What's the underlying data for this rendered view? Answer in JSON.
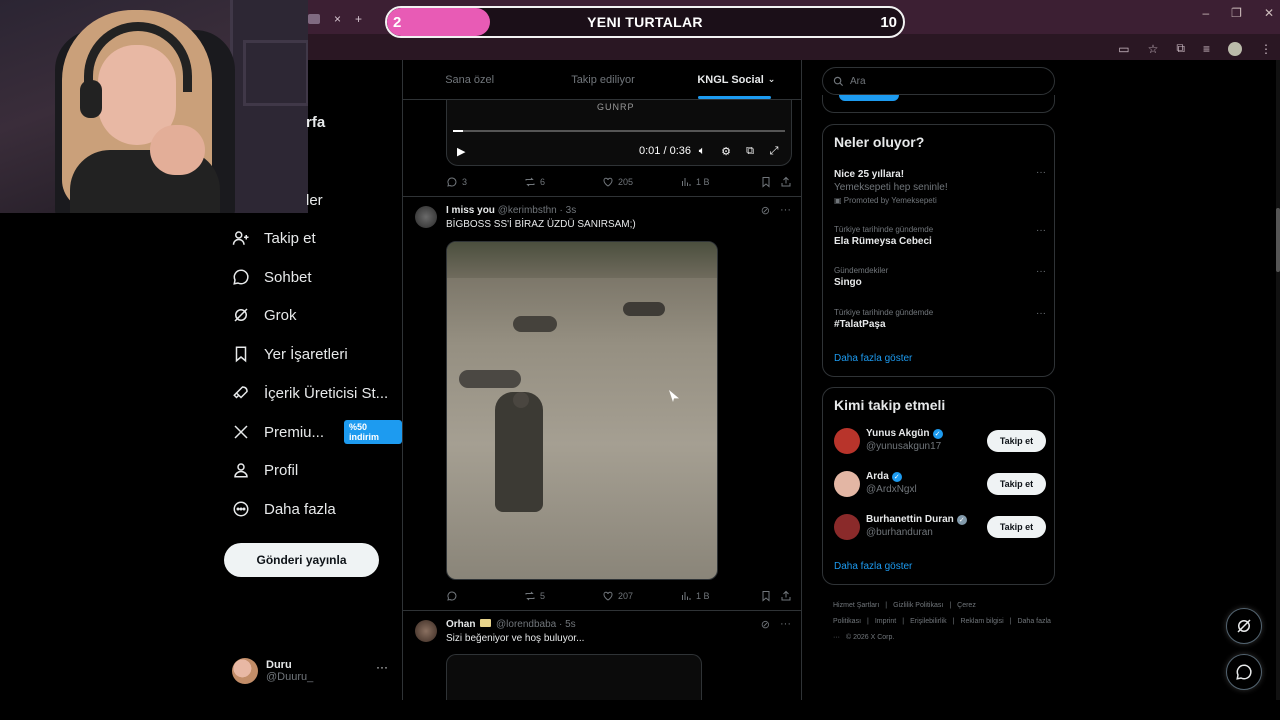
{
  "browser": {
    "new_tab_symbol": "+",
    "close_tab_symbol": "×",
    "window_controls": [
      "–",
      "❐",
      "✕"
    ],
    "toolbar_icons": [
      "cast-icon",
      "star-icon",
      "extensions-icon",
      "media-icon",
      "profile-avatar",
      "menu-icon"
    ]
  },
  "overlay": {
    "left_value": "2",
    "title": "YENI TURTALAR",
    "right_value": "10",
    "progress_fraction": 0.2,
    "fill_color": "#e85bb5"
  },
  "nav": {
    "partial_top": "rfa",
    "partial_second": "ler",
    "items": [
      {
        "label": "Takip et",
        "icon": "add-user-icon"
      },
      {
        "label": "Sohbet",
        "icon": "chat-icon"
      },
      {
        "label": "Grok",
        "icon": "grok-icon"
      },
      {
        "label": "Yer İşaretleri",
        "icon": "bookmark-icon"
      },
      {
        "label": "İçerik Üreticisi St...",
        "icon": "rocket-icon"
      },
      {
        "label": "Premiu...",
        "icon": "x-logo-icon",
        "badge": "%50 indirim"
      },
      {
        "label": "Profil",
        "icon": "person-icon"
      },
      {
        "label": "Daha fazla",
        "icon": "more-circle-icon"
      }
    ],
    "post_button": "Gönderi yayınla",
    "account": {
      "name": "Duru",
      "handle": "@Duuru_",
      "more": "···"
    }
  },
  "timeline": {
    "tabs": [
      {
        "label": "Sana özel",
        "active": false
      },
      {
        "label": "Takip ediliyor",
        "active": false
      },
      {
        "label": "KNGL Social",
        "active": true
      }
    ],
    "video": {
      "watermark": "GUNRP",
      "time": "0:01 / 0:36",
      "progress_fraction": 0.03
    },
    "first_actions": {
      "replies": "3",
      "reposts": "6",
      "likes": "205",
      "views": "1 B"
    },
    "posts": [
      {
        "name": "I miss you",
        "handle": "@kerimbsthn",
        "time": "· 3s",
        "text": "BİGBOSS SS'İ BİRAZ ÜZDÜ SANIRSAM;)",
        "actions": {
          "replies": "",
          "reposts": "5",
          "likes": "207",
          "views": "1 B"
        }
      },
      {
        "name": "Orhan",
        "handle": "@lorendbaba",
        "time": "· 5s",
        "text": "Sizi beğeniyor ve hoş buluyor..."
      }
    ]
  },
  "sidebar": {
    "search_placeholder": "Ara",
    "trends_title": "Neler oluyor?",
    "trends": [
      {
        "meta": "",
        "name": "Nice 25 yıllara!",
        "sub": "Yemeksepeti hep seninle!",
        "promo": "Promoted by Yemeksepeti"
      },
      {
        "meta": "Türkiye tarihinde gündemde",
        "name": "Ela Rümeysa Cebeci",
        "sub": "",
        "promo": ""
      },
      {
        "meta": "Gündemdekiler",
        "name": "Singo",
        "sub": "",
        "promo": ""
      },
      {
        "meta": "Türkiye tarihinde gündemde",
        "name": "#TalatPaşa",
        "sub": "",
        "promo": ""
      }
    ],
    "trends_more": "Daha fazla göster",
    "who_title": "Kimi takip etmeli",
    "who": [
      {
        "name": "Yunus Akgün",
        "handle": "@yunusakgun17",
        "verified": "blue",
        "button": "Takip et",
        "avatar_color": "#b8342b"
      },
      {
        "name": "Arda",
        "handle": "@ArdxNgxl",
        "verified": "blue",
        "button": "Takip et",
        "avatar_color": "#e3b6a4"
      },
      {
        "name": "Burhanettin Duran",
        "handle": "@burhanduran",
        "verified": "grey",
        "button": "Takip et",
        "avatar_color": "#8a2a2a"
      }
    ],
    "who_more": "Daha fazla göster",
    "footer": [
      "Hizmet Şartları",
      "|",
      "Gizlilik Politikası",
      "|",
      "Çerez Politikası",
      "|",
      "Imprint",
      "|",
      "Erişilebilirlik",
      "|",
      "Reklam bilgisi",
      "|",
      "Daha fazla ···",
      "© 2026 X Corp."
    ]
  },
  "colors": {
    "accent": "#1d9bf0",
    "background": "#000000",
    "border": "#2f3336",
    "muted": "#71767b"
  }
}
